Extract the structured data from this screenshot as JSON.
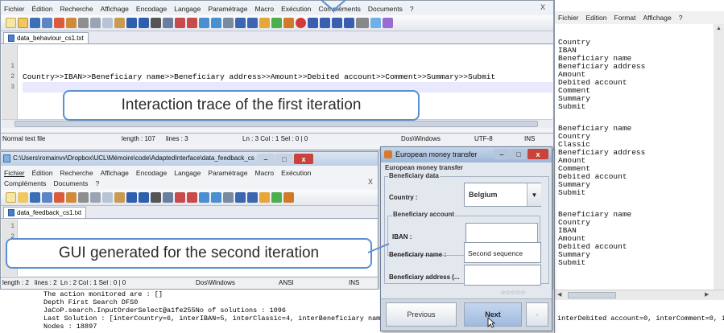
{
  "editor1": {
    "menu": [
      "Fichier",
      "Édition",
      "Recherche",
      "Affichage",
      "Encodage",
      "Langage",
      "Paramétrage",
      "Macro",
      "Exécution",
      "Compléments",
      "Documents",
      "?"
    ],
    "close_glyph": "X",
    "tab": "data_behaviour_cs1.txt",
    "line_numbers": [
      "1",
      "2",
      "3"
    ],
    "lines": [
      "",
      "Country>>IBAN>>Beneficiary name>>Beneficiary address>>Amount>>Debited account>>Comment>>Summary>>Submit",
      ""
    ],
    "status": {
      "type": "Normal text file",
      "length": "length : 107",
      "lines": "lines : 3",
      "pos": "Ln : 3   Col : 1   Sel : 0 | 0",
      "eol": "Dos\\Windows",
      "enc": "UTF-8",
      "mode": "INS"
    }
  },
  "editor2": {
    "title": "C:\\Users\\romainvv\\Dropbox\\UCL\\Mémoire\\code\\AdaptedInterface\\data_feedback_cs1.txt - Not...",
    "menu": [
      "Fichier",
      "Édition",
      "Recherche",
      "Affichage",
      "Encodage",
      "Langage",
      "Paramétrage",
      "Macro",
      "Exécution"
    ],
    "menu2": [
      "Compléments",
      "Documents",
      "?"
    ],
    "close_glyph": "X",
    "tab": "data_feedback_cs1.txt",
    "line_numbers": [
      "1",
      "2"
    ],
    "status": {
      "length": "length : 2",
      "lines": "lines : 2",
      "pos": "Ln : 2   Col : 1   Sel : 0 | 0",
      "eol": "Dos\\Windows",
      "enc": "ANSI",
      "mode": "INS"
    }
  },
  "notepad": {
    "menu": [
      "Fichier",
      "Edition",
      "Format",
      "Affichage",
      "?"
    ],
    "blocks": [
      [
        "Country",
        "IBAN",
        "Beneficiary name",
        "Beneficiary address",
        "Amount",
        "Debited account",
        "Comment",
        "Summary",
        "Submit"
      ],
      [
        "Beneficiary name",
        "Country",
        "Classic",
        "Beneficiary address",
        "Amount",
        "Comment",
        "Debited account",
        "Summary",
        "Submit"
      ],
      [
        "Beneficiary name",
        "Country",
        "IBAN",
        "Amount",
        "Debited account",
        "Summary",
        "Submit"
      ]
    ]
  },
  "console": {
    "lines": [
      "The action monitored are : []",
      "Depth First Search DFS0",
      "JaCoP.search.InputOrderSelect@a1fe255No of solutions : 1096",
      "Last Solution : [interCountry=6, interIBAN=5, interClassic=4, interBeneficiary name=3,",
      "Nodes : 18897"
    ],
    "right_fragment": "interDebited account=0, interComment=0, in"
  },
  "dialog": {
    "title": "European money transfer",
    "subtitle": "European money transfer",
    "section": "Beneficiary data",
    "country_label": "Country :",
    "country_value": "Belgium",
    "account_section": "Beneficiary account",
    "iban_label": "IBAN :",
    "name_label": "Beneficiary name :",
    "name_value": "Second sequence",
    "address_label": "Beneficiary address (...",
    "rating": "☆☆☆☆☆",
    "previous": "Previous",
    "next": "Next",
    "extra": "·"
  },
  "callouts": {
    "first": "Interaction trace of the first iteration",
    "second": "GUI generated for the second iteration"
  },
  "colors": {
    "accent": "#5a8fd0",
    "dialog_header": "#c8d5e6",
    "window_close": "#c8433a"
  }
}
